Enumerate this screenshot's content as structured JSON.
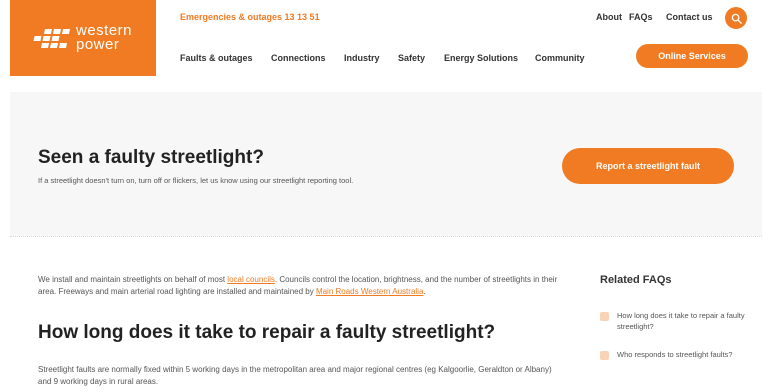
{
  "brand": {
    "logo_line1": "western",
    "logo_line2": "power",
    "accent_color": "#f07b22"
  },
  "header": {
    "emergency": "Emergencies & outages 13 13 51",
    "utility_links": [
      "About",
      "FAQs",
      "Contact us"
    ],
    "search_icon": "search-icon",
    "nav_items": [
      "Faults & outages",
      "Connections",
      "Industry",
      "Safety",
      "Energy Solutions",
      "Community"
    ],
    "online_services": "Online Services"
  },
  "hero": {
    "title": "Seen a faulty streetlight?",
    "subtitle": "If a streetlight doesn't turn on, turn off or flickers, let us know using our streetlight reporting tool.",
    "report_button": "Report a streetlight fault"
  },
  "main": {
    "intro_part1": "We install and maintain streetlights on behalf of most ",
    "intro_link1": "local councils",
    "intro_part2": ". Councils control the location, brightness, and the number of streetlights in their area. Freeways and main arterial road lighting are installed and maintained by ",
    "intro_link2": "Main Roads Western Australia",
    "intro_part3": ".",
    "question_title": "How long does it take to repair a faulty streetlight?",
    "question_body": "Streetlight faults are normally fixed within 5 working days in the metropolitan area and major regional centres (eg Kalgoorlie, Geraldton or Albany) and 9 working days in rural areas."
  },
  "faq": {
    "heading": "Related FAQs",
    "items": [
      "How long does it take to repair a faulty streetlight?",
      "Who responds to streetlight faults?"
    ]
  }
}
